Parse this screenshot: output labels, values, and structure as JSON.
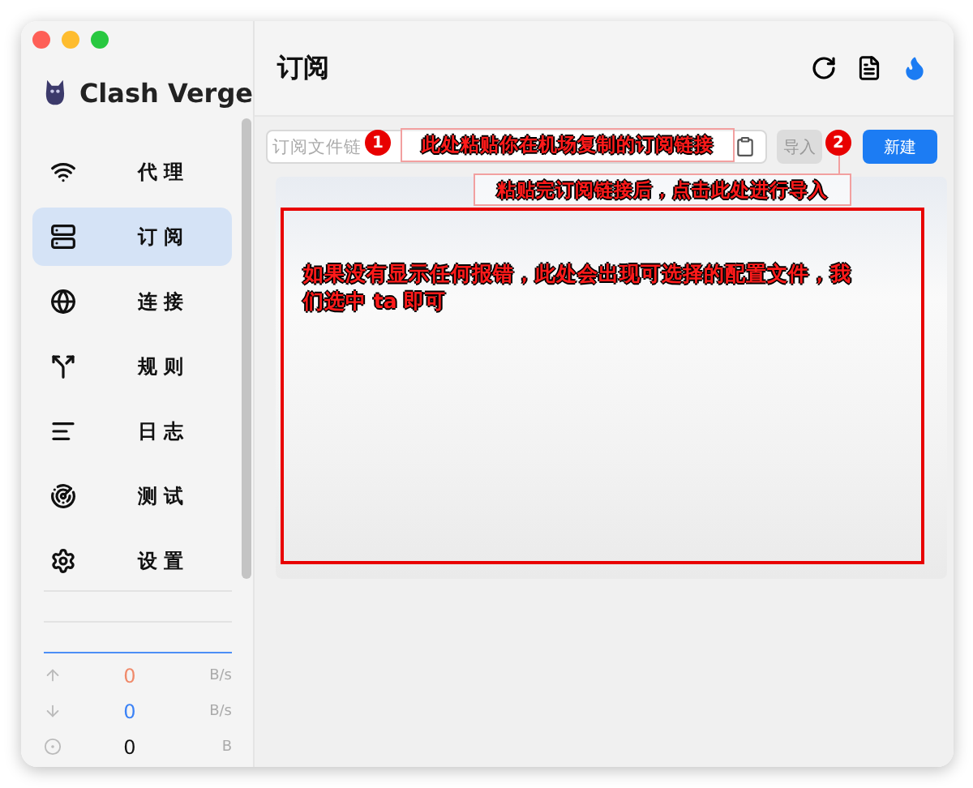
{
  "sidebar": {
    "app_name": "Clash Verge",
    "nav": [
      {
        "label": "代 理",
        "selected": false
      },
      {
        "label": "订 阅",
        "selected": true
      },
      {
        "label": "连 接",
        "selected": false
      },
      {
        "label": "规 则",
        "selected": false
      },
      {
        "label": "日 志",
        "selected": false
      },
      {
        "label": "测 试",
        "selected": false
      },
      {
        "label": "设 置",
        "selected": false
      }
    ],
    "traffic": [
      {
        "kind": "up",
        "value": "0",
        "unit": "B/s"
      },
      {
        "kind": "down",
        "value": "0",
        "unit": "B/s"
      },
      {
        "kind": "total",
        "value": "0",
        "unit": "B"
      }
    ]
  },
  "main": {
    "title": "订阅",
    "import_field": {
      "placeholder": "订阅文件链"
    },
    "import_button": "导入",
    "new_button": "新建"
  },
  "annotations": [
    {
      "kind": "badge",
      "text": "1"
    },
    {
      "kind": "note",
      "text": "此处粘贴你在机场复制的订阅链接"
    },
    {
      "kind": "badge",
      "text": "2"
    },
    {
      "kind": "note",
      "text": "粘贴完订阅链接后，点击此处进行导入"
    },
    {
      "kind": "frame",
      "text": "如果没有显示任何报错，此处会出现可选择的配置文件，我们选中 ta 即可"
    }
  ]
}
